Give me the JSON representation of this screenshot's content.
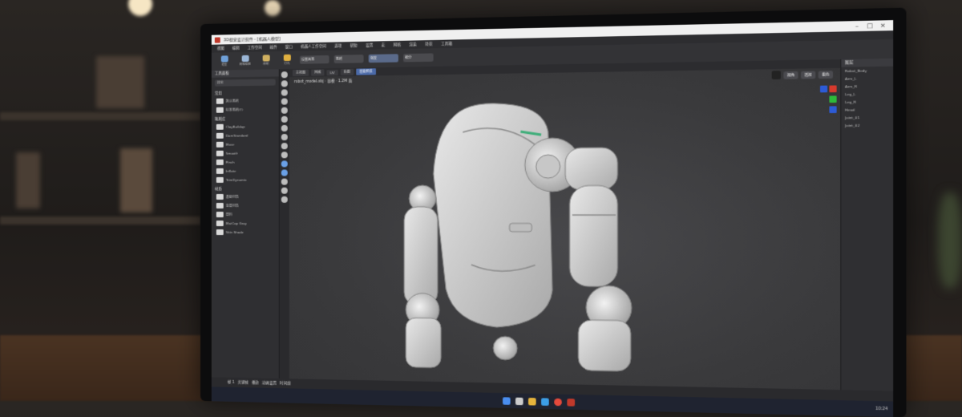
{
  "window": {
    "title": "3D视觉设计软件 - [机器人模型]"
  },
  "menubar": {
    "items": [
      "视图",
      "编辑",
      "工作空间",
      "插件",
      "窗口",
      "机器人工作空间",
      "选项",
      "帮助",
      "设置",
      "宏",
      "网格",
      "渲染",
      "场景",
      "工具箱"
    ]
  },
  "ribbon": {
    "buttons": [
      {
        "label": "造型",
        "color": "#6fa0d8",
        "icon": "sculpt-icon"
      },
      {
        "label": "网格编辑",
        "color": "#9bb6d6",
        "icon": "mesh-icon"
      },
      {
        "label": "绘制",
        "color": "#d0b060",
        "icon": "paint-icon"
      },
      {
        "label": "灯光",
        "color": "#e0b040",
        "icon": "light-icon"
      }
    ],
    "fields": [
      "设置画笔",
      "笔刷",
      "强度",
      "细分"
    ]
  },
  "left_panel": {
    "header": "工具面板",
    "sections": [
      {
        "title": "常用",
        "rows": [
          "默认笔刷",
          "标准笔刷(T)"
        ]
      },
      {
        "title": "笔刷库",
        "rows": [
          "ClayBuildup",
          "DamStandard",
          "Move",
          "Smooth",
          "Pinch",
          "Inflate",
          "TrimDynamic"
        ]
      },
      {
        "title": "材质",
        "rows": [
          "基础材质",
          "金属材质",
          "塑料",
          "MatCap Gray",
          "Skin Shade"
        ]
      }
    ],
    "search_placeholder": "搜索"
  },
  "viewport": {
    "tabs": [
      "主视图",
      "网格",
      "UV",
      "贴图",
      "渲染预览"
    ],
    "active_tab": "渲染预览",
    "path": "robot_model.obj · 高模 · 1.2M 面",
    "top_buttons": [
      "视角",
      "透视",
      "着色"
    ],
    "color_chips": [
      "#2d5bd6",
      "#d63a2d",
      "#2dbb3a",
      "#2d5bd6"
    ]
  },
  "right_panel": {
    "header": "图层",
    "rows": [
      "Robot_Body",
      "Arm_L",
      "Arm_R",
      "Leg_L",
      "Leg_R",
      "Head",
      "Joint_01",
      "Joint_02"
    ]
  },
  "timeline": {
    "items": [
      "帧 1",
      "关键帧",
      "播放",
      "动画设置",
      "时间线"
    ]
  },
  "taskbar": {
    "icons": [
      {
        "name": "start-icon",
        "color": "#4a8ef0"
      },
      {
        "name": "search-icon",
        "color": "#cccccc"
      },
      {
        "name": "explorer-icon",
        "color": "#e6b43c"
      },
      {
        "name": "browser-icon",
        "color": "#3c9ee6"
      },
      {
        "name": "chrome-icon",
        "color": "#e64a3c"
      },
      {
        "name": "app-icon",
        "color": "#c0392b"
      }
    ],
    "tray_time": "10:24"
  }
}
